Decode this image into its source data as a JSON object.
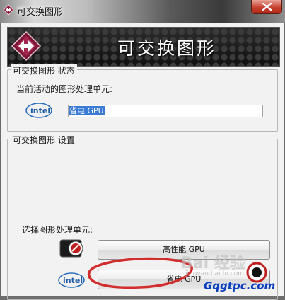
{
  "window": {
    "title": "可交换图形",
    "banner_title": "可交换图形",
    "close_icon": "close-x-icon"
  },
  "status_group": {
    "legend": "可交换图形 状态",
    "active_label": "当前活动的图形处理单元:",
    "active_value": "省电 GPU"
  },
  "settings_group": {
    "legend": "可交换图形 设置",
    "select_label": "选择图形处理单元:",
    "high_performance_button": "高性能 GPU",
    "power_saving_button": "省电 GPU"
  },
  "brand": {
    "intel_logo_text": "intel",
    "switch_icon": "diamond-arrows-icon",
    "amd_icon": "amd-radeon-icon"
  },
  "watermarks": {
    "baidu": "Bai 经验",
    "jingyan": "jingyan.baidu.com",
    "site": "Gqgtpc.com"
  },
  "colors": {
    "selection": "#3a7bd5",
    "annotation": "#d22d2d",
    "banner": "#1d1d1d",
    "watermark_site": "#0a3fbf"
  }
}
